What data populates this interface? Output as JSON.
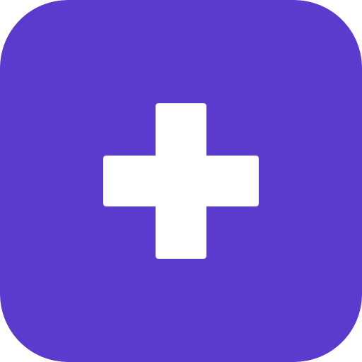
{
  "icon": {
    "name": "plus-icon",
    "background_color": "#5b3bcd",
    "symbol_color": "#ffffff"
  }
}
